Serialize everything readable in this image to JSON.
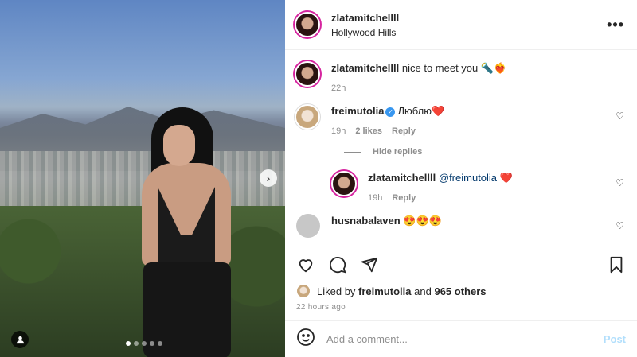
{
  "post": {
    "username": "zlatamitchellll",
    "location": "Hollywood Hills",
    "more_icon": "more-horizontal-icon"
  },
  "caption": {
    "username": "zlatamitchellll",
    "text": "nice to meet you 🔦❤️‍🔥",
    "time": "22h"
  },
  "comments": [
    {
      "username": "freimutolia",
      "verified": true,
      "text": "Люблю❤️",
      "time": "19h",
      "likes": "2 likes",
      "reply_label": "Reply",
      "hide_replies": "Hide replies",
      "replies": [
        {
          "username": "zlatamitchellll",
          "mention": "@freimutolia",
          "text": " ❤️",
          "time": "19h",
          "reply_label": "Reply"
        }
      ]
    },
    {
      "username": "husnabalaven",
      "text": "😍😍😍"
    }
  ],
  "carousel": {
    "total": 5,
    "active": 0
  },
  "likes": {
    "prefix": "Liked by",
    "user": "freimutolia",
    "middle": "and",
    "others": "965 others"
  },
  "timestamp": "22 hours ago",
  "add_comment": {
    "placeholder": "Add a comment...",
    "post_label": "Post"
  }
}
